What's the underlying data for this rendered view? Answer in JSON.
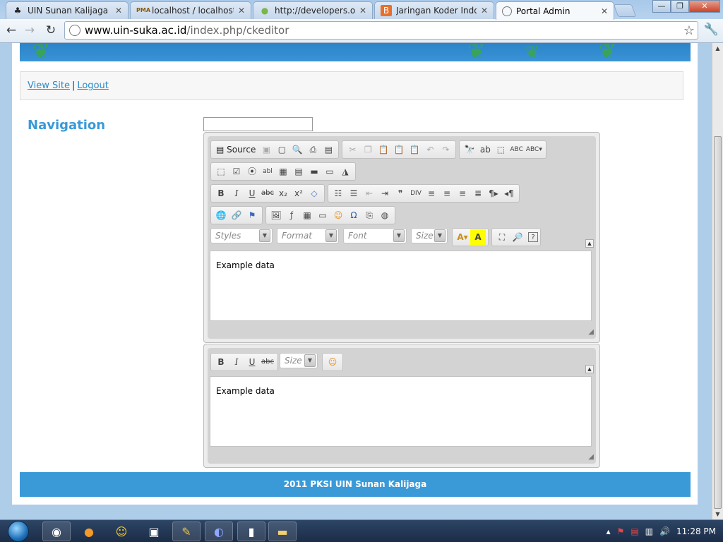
{
  "browser": {
    "tabs": [
      {
        "title": "UIN Sunan Kalijaga Yog",
        "icon": "uin-icon"
      },
      {
        "title": "localhost / localhost / c",
        "icon": "phpmyadmin-icon"
      },
      {
        "title": "http://developers.or.id/",
        "icon": "android-icon"
      },
      {
        "title": "Jaringan Koder Indones",
        "icon": "blogger-icon"
      },
      {
        "title": "Portal Admin",
        "icon": "page-icon"
      }
    ],
    "url_host": "www.uin-suka.ac.id",
    "url_path": "/index.php/ckeditor"
  },
  "admin_bar": {
    "view_site": "View Site",
    "separator": "|",
    "logout": "Logout"
  },
  "nav_title": "Navigation",
  "editor1": {
    "source_label": "Source",
    "combos": [
      "Styles",
      "Format",
      "Font",
      "Size"
    ],
    "content": "Example data"
  },
  "editor2": {
    "combos": [
      "Size"
    ],
    "content": "Example data"
  },
  "footer": "2011 PKSI UIN Sunan Kalijaga",
  "taskbar": {
    "clock": "11:28 PM"
  }
}
